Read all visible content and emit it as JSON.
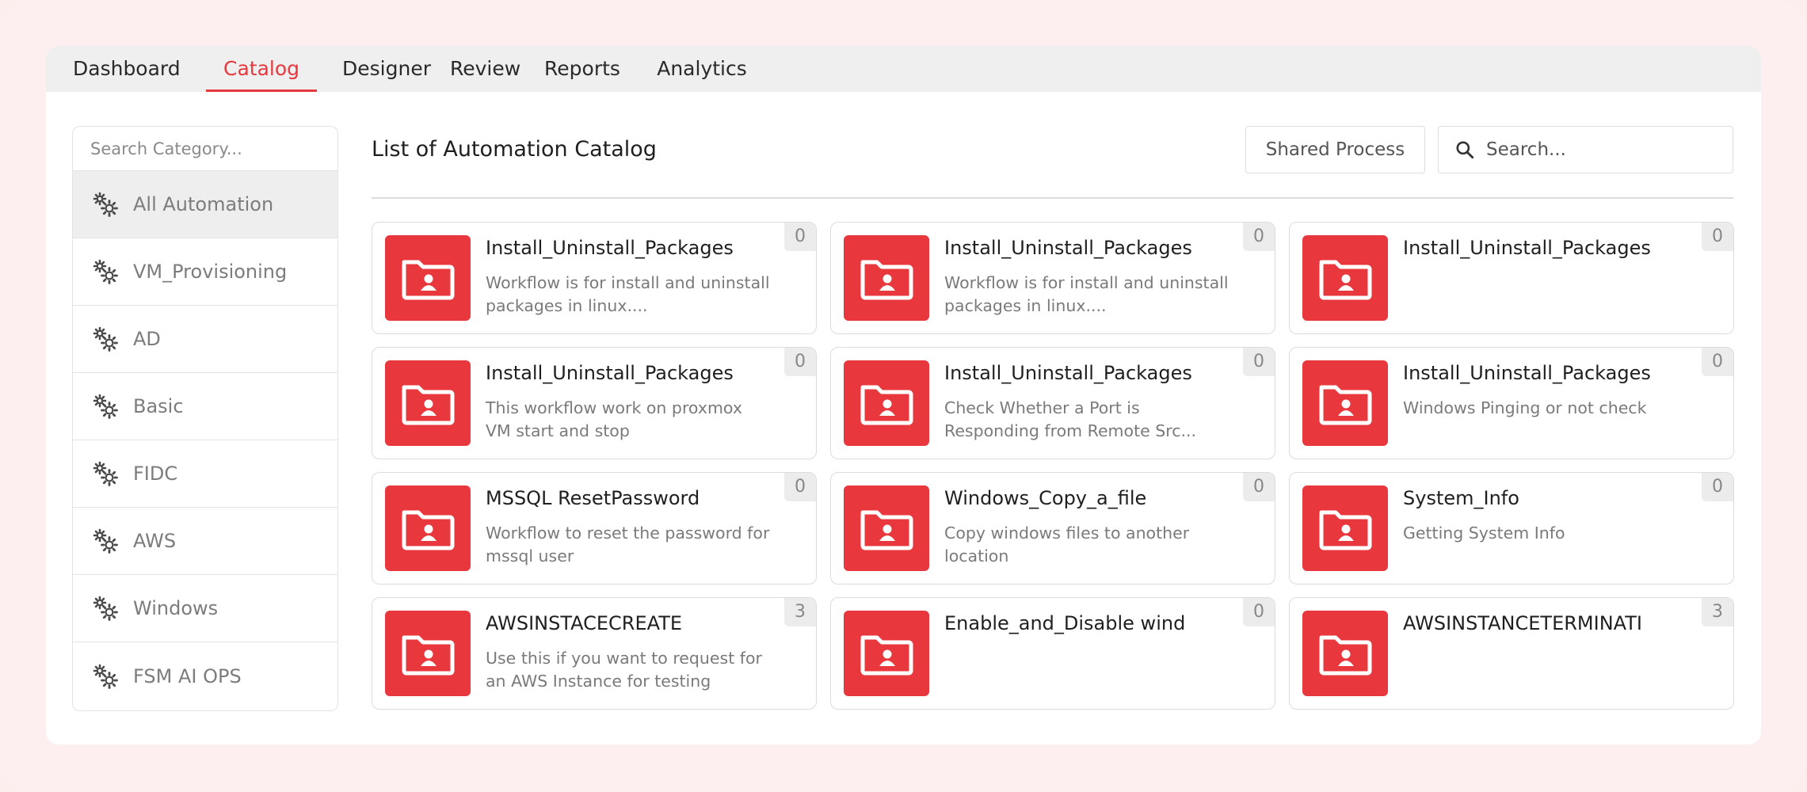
{
  "tabs": [
    {
      "label": "Dashboard",
      "active": false
    },
    {
      "label": "Catalog",
      "active": true
    },
    {
      "label": "Designer",
      "active": false
    },
    {
      "label": "Review",
      "active": false
    },
    {
      "label": "Reports",
      "active": false
    },
    {
      "label": "Analytics",
      "active": false
    }
  ],
  "sidebar": {
    "search_placeholder": "Search Category...",
    "items": [
      {
        "label": "All Automation",
        "icon": "gears-icon",
        "selected": true
      },
      {
        "label": "VM_Provisioning",
        "icon": "gears-icon",
        "selected": false
      },
      {
        "label": "AD",
        "icon": "gears-icon",
        "selected": false
      },
      {
        "label": "Basic",
        "icon": "gears-icon",
        "selected": false
      },
      {
        "label": "FIDC",
        "icon": "gears-icon",
        "selected": false
      },
      {
        "label": "AWS",
        "icon": "gears-icon",
        "selected": false
      },
      {
        "label": "Windows",
        "icon": "gears-icon",
        "selected": false
      },
      {
        "label": "FSM AI OPS",
        "icon": "gears-icon",
        "selected": false
      }
    ]
  },
  "main": {
    "title": "List of Automation Catalog",
    "shared_process_label": "Shared Process",
    "search_placeholder": "Search..."
  },
  "colors": {
    "accent": "#e6393e",
    "card_icon_bg": "#e8383d"
  },
  "cards": [
    {
      "name": "Install_Uninstall_Packages",
      "desc": "Workflow is for install and uninstall packages in linux....",
      "count": "0",
      "icon": "folder-user-icon"
    },
    {
      "name": "Install_Uninstall_Packages",
      "desc": "Workflow is for install and uninstall packages in linux....",
      "count": "0",
      "icon": "folder-user-icon"
    },
    {
      "name": "Install_Uninstall_Packages",
      "desc": "",
      "count": "0",
      "icon": "folder-user-icon"
    },
    {
      "name": "Install_Uninstall_Packages",
      "desc": "This workflow work on proxmox VM start and stop",
      "count": "0",
      "icon": "folder-user-icon"
    },
    {
      "name": "Install_Uninstall_Packages",
      "desc": "Check Whether a Port is Responding from Remote Src...",
      "count": "0",
      "icon": "folder-user-icon"
    },
    {
      "name": "Install_Uninstall_Packages",
      "desc": "Windows Pinging or not check",
      "count": "0",
      "icon": "folder-user-icon"
    },
    {
      "name": "MSSQL ResetPassword",
      "desc": "Workflow to reset the password for mssql user",
      "count": "0",
      "icon": "folder-user-icon"
    },
    {
      "name": "Windows_Copy_a_file",
      "desc": "Copy windows files to another location",
      "count": "0",
      "icon": "folder-user-icon"
    },
    {
      "name": "System_Info",
      "desc": "Getting System Info",
      "count": "0",
      "icon": "folder-user-icon"
    },
    {
      "name": "AWSINSTACECREATE",
      "desc": "Use this if you want to request for an AWS Instance for testing",
      "count": "3",
      "icon": "folder-user-icon"
    },
    {
      "name": "Enable_and_Disable wind",
      "desc": "",
      "count": "0",
      "icon": "folder-user-icon"
    },
    {
      "name": "AWSINSTANCETERMINATI",
      "desc": "",
      "count": "3",
      "icon": "folder-user-icon"
    }
  ]
}
